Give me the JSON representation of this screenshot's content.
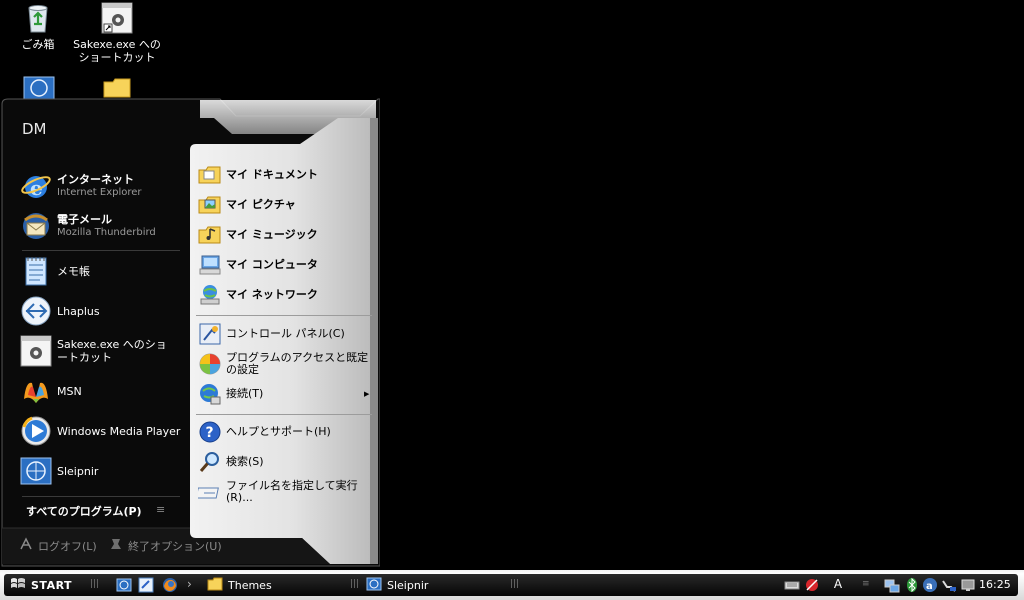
{
  "desktop": {
    "icons": [
      {
        "label": "ごみ箱",
        "icon": "recycle-bin-icon"
      },
      {
        "label": "Sakexe.exe へのショートカット",
        "icon": "sakexe-shortcut-icon"
      },
      {
        "label": "",
        "icon": "sleipnir-icon"
      },
      {
        "label": "",
        "icon": "folder-icon"
      }
    ]
  },
  "start_menu": {
    "user_name": "DM",
    "pinned": [
      {
        "title": "インターネット",
        "subtitle": "Internet Explorer",
        "icon": "internet-explorer-icon"
      },
      {
        "title": "電子メール",
        "subtitle": "Mozilla Thunderbird",
        "icon": "thunderbird-icon"
      }
    ],
    "recent": [
      {
        "title": "メモ帳",
        "icon": "notepad-icon"
      },
      {
        "title": "Lhaplus",
        "icon": "lhaplus-icon"
      },
      {
        "title": "Sakexe.exe へのショートカット",
        "icon": "sakexe-icon"
      },
      {
        "title": "MSN",
        "icon": "msn-icon"
      },
      {
        "title": "Windows Media Player",
        "icon": "windows-media-player-icon"
      },
      {
        "title": "Sleipnir",
        "icon": "sleipnir-icon"
      }
    ],
    "all_programs": "すべてのプログラム(P)",
    "all_programs_glyph": "≡",
    "logoff": "ログオフ(L)",
    "shutdown": "終了オプション(U)",
    "right_items": [
      {
        "label": "マイ ドキュメント",
        "icon": "my-documents-icon",
        "bold": true
      },
      {
        "label": "マイ ピクチャ",
        "icon": "my-pictures-icon",
        "bold": true
      },
      {
        "label": "マイ ミュージック",
        "icon": "my-music-icon",
        "bold": true
      },
      {
        "label": "マイ コンピュータ",
        "icon": "my-computer-icon",
        "bold": true
      },
      {
        "label": "マイ ネットワーク",
        "icon": "my-network-icon",
        "bold": true
      },
      {
        "label": "コントロール パネル(C)",
        "icon": "control-panel-icon",
        "bold": false
      },
      {
        "label": "プログラムのアクセスと既定の設定",
        "icon": "program-access-icon",
        "bold": false
      },
      {
        "label": "接続(T)",
        "icon": "connect-icon",
        "bold": false
      },
      {
        "label": "ヘルプとサポート(H)",
        "icon": "help-icon",
        "bold": false
      },
      {
        "label": "検索(S)",
        "icon": "search-icon",
        "bold": false
      },
      {
        "label": "ファイル名を指定して実行(R)...",
        "icon": "run-icon",
        "bold": false
      }
    ],
    "connect_arrow": "▶"
  },
  "taskbar": {
    "start_label": "START",
    "grip": "|||",
    "tasks": [
      {
        "label": "Themes",
        "icon": "folder-icon"
      },
      {
        "label": "Sleipnir",
        "icon": "sleipnir-icon"
      }
    ],
    "chevron": "›",
    "language_indicator": "A",
    "clock": "16:25"
  },
  "colors": {
    "desktop": "#000000",
    "menu_left": "#0c0c0c",
    "menu_right": "#e8e8e8",
    "taskbar": "#0a0a0a"
  }
}
